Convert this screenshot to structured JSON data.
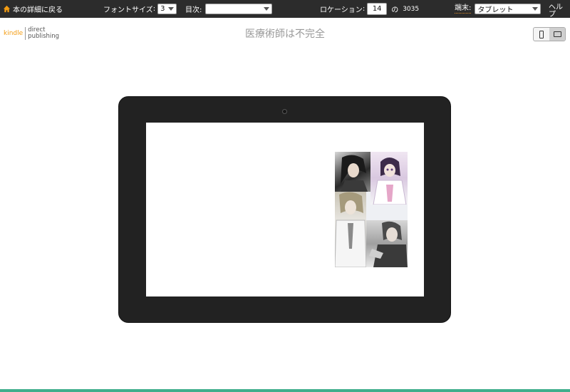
{
  "toolbar": {
    "back_label": "本の詳細に戻る",
    "font_size_label": "フォントサイズ",
    "font_size_value": "3",
    "toc_label": "目次:",
    "toc_value": "",
    "location_label": "ロケーション",
    "location_value": "14",
    "location_of": "の",
    "location_total": "3035",
    "device_label": "端末:",
    "device_value": "タブレット",
    "help_label": "ヘルプ"
  },
  "header": {
    "logo_kindle": "kindle",
    "logo_direct": "direct",
    "logo_publishing": "publishing",
    "book_title": "医療術師は不完全"
  },
  "cover": {
    "captions": [
      "",
      "",
      "",
      ""
    ]
  },
  "colors": {
    "toolbar_bg": "#2c2c2c",
    "device_frame": "#222222",
    "accent_orange": "#f39c12",
    "bottom_line": "#3fae8c"
  },
  "icons": {
    "back": "home-icon",
    "portrait": "phone-portrait-icon",
    "landscape": "tablet-landscape-icon"
  }
}
